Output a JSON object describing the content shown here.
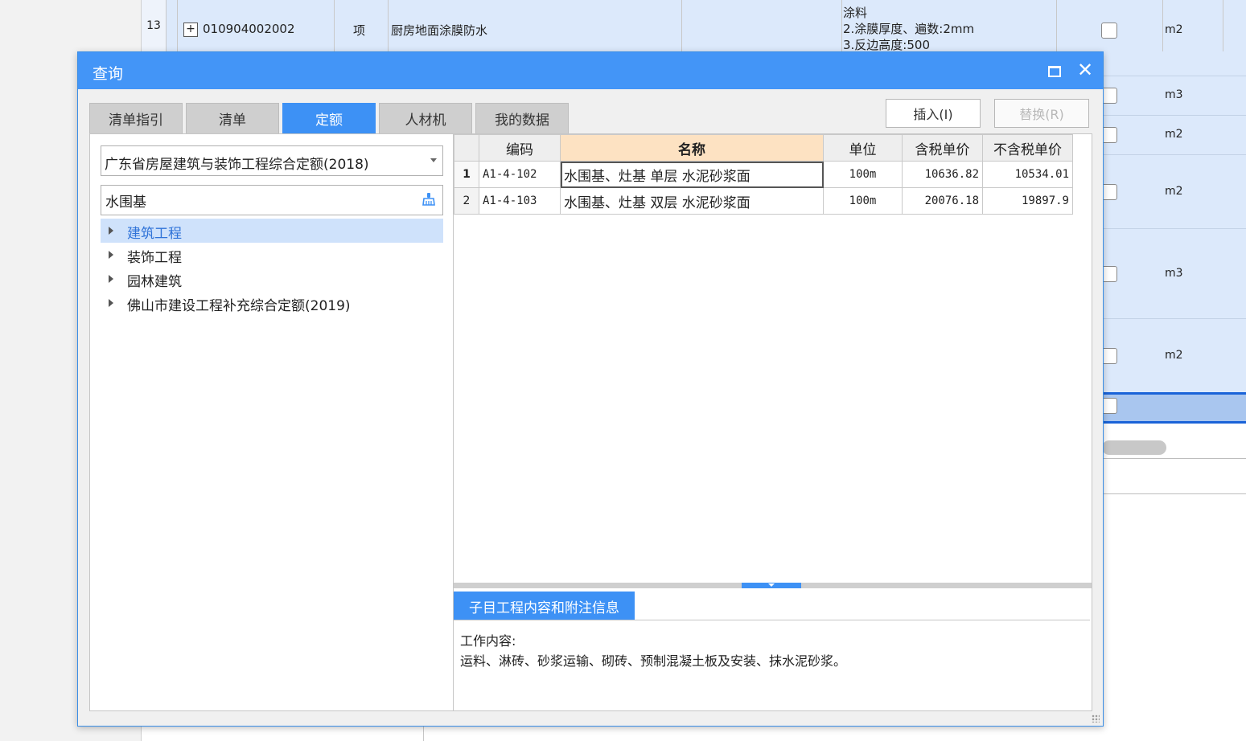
{
  "background_sheet": {
    "row": {
      "number": "13",
      "code": "010904002002",
      "type": "项",
      "name": "厨房地面涂膜防水",
      "desc_lines": [
        "涂料",
        "2.涂膜厚度、遍数:2mm",
        "3.反边高度:500"
      ],
      "unit": "m2"
    },
    "right_units": [
      "m3",
      "m2",
      "m2",
      "m3",
      "m2"
    ],
    "plus_icon": "plus-square-icon"
  },
  "dialog": {
    "title": "查询",
    "maximize_icon": "maximize-icon",
    "close_icon": "close-icon",
    "tabs": [
      {
        "label": "清单指引",
        "active": false
      },
      {
        "label": "清单",
        "active": false
      },
      {
        "label": "定额",
        "active": true
      },
      {
        "label": "人材机",
        "active": false
      },
      {
        "label": "我的数据",
        "active": false
      }
    ],
    "insert_label": "插入(I)",
    "replace_label": "替换(R)",
    "accent_color": "#3d91f5"
  },
  "left": {
    "quota_library": "广东省房屋建筑与装饰工程综合定额(2018)",
    "search_value": "水围基",
    "search_icon": "broom-clear-icon",
    "tree": [
      {
        "label": "建筑工程",
        "selected": true
      },
      {
        "label": "装饰工程",
        "selected": false
      },
      {
        "label": "园林建筑",
        "selected": false
      },
      {
        "label": "佛山市建设工程补充综合定额(2019)",
        "selected": false
      }
    ]
  },
  "grid": {
    "headers": {
      "code": "编码",
      "name": "名称",
      "unit": "单位",
      "price_tax": "含税单价",
      "price_notax": "不含税单价"
    },
    "rows": [
      {
        "no": "1",
        "code": "A1-4-102",
        "name": "水围基、灶基 单层 水泥砂浆面",
        "unit": "100m",
        "price_tax": "10636.82",
        "price_notax": "10534.01"
      },
      {
        "no": "2",
        "code": "A1-4-103",
        "name": "水围基、灶基 双层 水泥砂浆面",
        "unit": "100m",
        "price_tax": "20076.18",
        "price_notax": "19897.9"
      }
    ]
  },
  "info": {
    "tab_label": "子目工程内容和附注信息",
    "work_content_label": "工作内容:",
    "work_content": "运料、淋砖、砂浆运输、砌砖、预制混凝土板及安装、抹水泥砂浆。"
  }
}
